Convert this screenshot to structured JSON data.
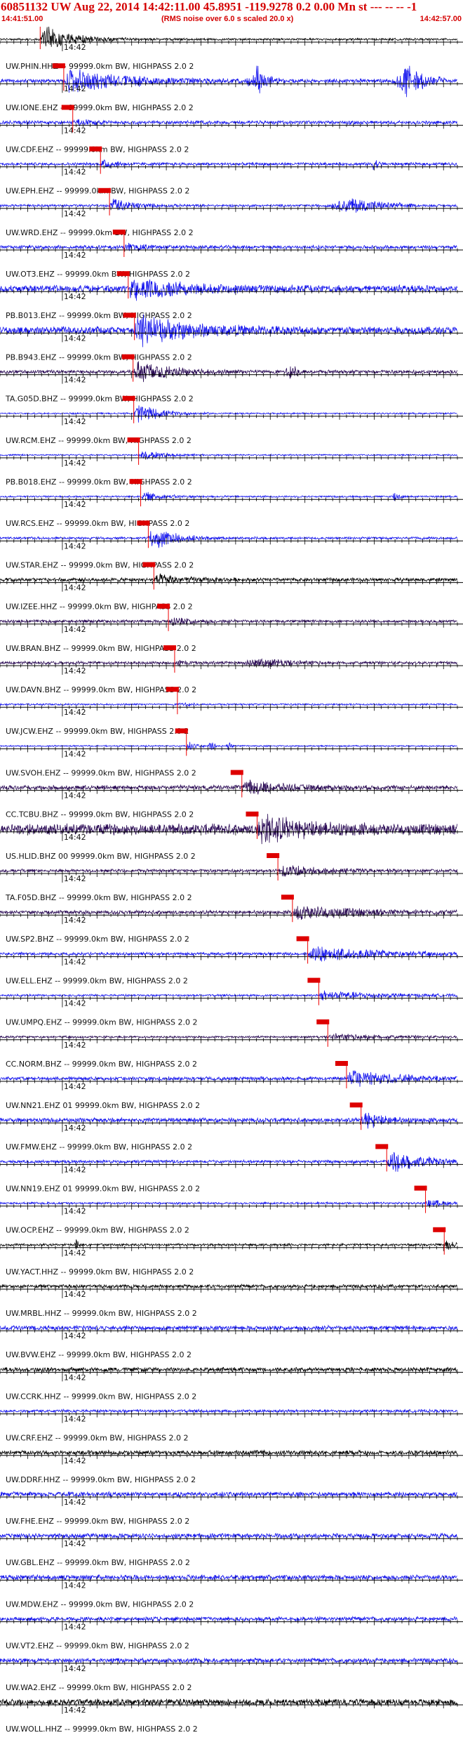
{
  "header": {
    "title": "60851132 UW Aug 22, 2014 14:42:11.00   45.8951 -119.9278  0.2 0.00 Mn st --- -- -- -1",
    "start_time": "14:41:51.00",
    "rms_note": "(RMS noise over 6.0 s scaled 20.0 x)",
    "end_time": "14:42:57.00"
  },
  "colors": {
    "header_text": "#d40000",
    "pick_box": "#dd0000",
    "pick_line": "#ee0000",
    "blue_trace": "#1515ee",
    "black_trace": "#000000",
    "purple_trace": "#2a0a55"
  },
  "chart_data": {
    "type": "line",
    "title": "60851132 UW Aug 22, 2014 14:42:11.00   45.8951 -119.9278  0.2 0.00 Mn st --- -- -- -1",
    "x_unit": "seconds after 14:41:51.00",
    "xlim": [
      0,
      66
    ],
    "tick_label": "14:42",
    "tick_label_at": 9,
    "minor_tick_spacing_s": 1,
    "major_tick_spacing_s": 5,
    "origin_time_s": 20,
    "series": [
      {
        "name": "UW.PHIN.HHZ -- 99999.0km BW, HIGHPASS  2.0  2",
        "color": "black",
        "pick": 5.8,
        "amp": 0.95,
        "noise": 0.07,
        "dur": 9,
        "extra": []
      },
      {
        "name": "UW.IONE.EHZ -- 99999.0km BW, HIGHPASS  2.0  2",
        "color": "blue",
        "pick": 9.2,
        "amp": 0.9,
        "noise": 0.12,
        "dur": 18,
        "extra": [
          [
            37,
            0.9,
            1.5
          ],
          [
            59,
            1.0,
            2.5
          ]
        ]
      },
      {
        "name": "UW.CDF.EHZ -- 99999.0km BW, HIGHPASS  2.0  2",
        "color": "blue",
        "pick": 10.5,
        "amp": 0.22,
        "noise": 0.12,
        "dur": 6,
        "extra": []
      },
      {
        "name": "UW.EPH.EHZ -- 99999.0km BW, HIGHPASS  2.0  2",
        "color": "blue",
        "pick": 14.5,
        "amp": 0.55,
        "noise": 0.1,
        "dur": 3,
        "extra": [
          [
            54,
            0.35,
            0.6
          ]
        ]
      },
      {
        "name": "UW.WRD.EHZ -- 99999.0km BW, HIGHPASS  2.0  2",
        "color": "blue",
        "pick": 15.8,
        "amp": 0.55,
        "noise": 0.08,
        "dur": 6,
        "extra": [
          [
            51,
            0.5,
            4
          ]
        ]
      },
      {
        "name": "UW.OT3.EHZ -- 99999.0km BW, HIGHPASS  2.0  2",
        "color": "blue",
        "pick": 17.9,
        "amp": 0.28,
        "noise": 0.12,
        "dur": 5,
        "extra": []
      },
      {
        "name": "PB.B013.EHZ -- 99999.0km BW, HIGHPASS  2.0  2",
        "color": "blue",
        "pick": 18.5,
        "amp": 0.8,
        "noise": 0.22,
        "dur": 16,
        "extra": []
      },
      {
        "name": "PB.B943.EHZ -- 99999.0km BW, HIGHPASS  2.0  2",
        "color": "blue",
        "pick": 19.4,
        "amp": 0.95,
        "noise": 0.25,
        "dur": 16,
        "extra": []
      },
      {
        "name": "TA.G05D.BHZ -- 99999.0km BW, HIGHPASS  2.0  2",
        "color": "purple",
        "pick": 19.2,
        "amp": 0.75,
        "noise": 0.12,
        "dur": 10,
        "extra": [
          [
            42,
            0.4,
            1
          ]
        ]
      },
      {
        "name": "UW.RCM.EHZ -- 99999.0km BW, HIGHPASS  2.0  2",
        "color": "blue",
        "pick": 19.3,
        "amp": 0.9,
        "noise": 0.05,
        "dur": 6,
        "extra": []
      },
      {
        "name": "PB.B018.EHZ -- 99999.0km BW, HIGHPASS  2.0  2",
        "color": "blue",
        "pick": 20.0,
        "amp": 0.4,
        "noise": 0.05,
        "dur": 6,
        "extra": []
      },
      {
        "name": "UW.RCS.EHZ -- 99999.0km BW, HIGHPASS  2.0  2",
        "color": "blue",
        "pick": 20.3,
        "amp": 0.35,
        "noise": 0.06,
        "dur": 6,
        "extra": [
          [
            57,
            0.35,
            0.6
          ]
        ]
      },
      {
        "name": "UW.STAR.EHZ -- 99999.0km BW, HIGHPASS  2.0  2",
        "color": "blue",
        "pick": 21.4,
        "amp": 0.9,
        "noise": 0.08,
        "dur": 7,
        "extra": []
      },
      {
        "name": "UW.IZEE.HHZ -- 99999.0km BW, HIGHPASS  2.0  2",
        "color": "black",
        "pick": 22.2,
        "amp": 0.35,
        "noise": 0.12,
        "dur": 8,
        "extra": []
      },
      {
        "name": "UW.BRAN.BHZ -- 99999.0km BW, HIGHPASS  2.0  2",
        "color": "purple",
        "pick": 24.3,
        "amp": 0.3,
        "noise": 0.1,
        "dur": 6,
        "extra": []
      },
      {
        "name": "UW.DAVN.BHZ -- 99999.0km BW, HIGHPASS  2.0  2",
        "color": "purple",
        "pick": 25.2,
        "amp": 0.15,
        "noise": 0.1,
        "dur": 4,
        "extra": [
          [
            38,
            0.25,
            4
          ]
        ]
      },
      {
        "name": "UW.JCW.EHZ -- 99999.0km BW, HIGHPASS  2.0  2",
        "color": "blue",
        "pick": 25.6,
        "amp": 0.15,
        "noise": 0.06,
        "dur": 3,
        "extra": []
      },
      {
        "name": "UW.SVOH.EHZ -- 99999.0km BW, HIGHPASS  2.0  2",
        "color": "blue",
        "pick": 26.9,
        "amp": 0.4,
        "noise": 0.05,
        "dur": 2,
        "extra": [
          [
            30.5,
            0.4,
            0.4
          ],
          [
            33,
            0.35,
            0.4
          ]
        ]
      },
      {
        "name": "CC.TCBU.BHZ -- 99999.0km BW, HIGHPASS  2.0  2",
        "color": "purple",
        "pick": 34.9,
        "amp": 0.5,
        "noise": 0.15,
        "dur": 10,
        "extra": []
      },
      {
        "name": "US.HLID.BHZ 00 99999.0km BW, HIGHPASS  2.0  2",
        "color": "purple",
        "pick": 37.1,
        "amp": 0.95,
        "noise": 0.35,
        "dur": 12,
        "extra": []
      },
      {
        "name": "TA.F05D.BHZ -- 99999.0km BW, HIGHPASS  2.0  2",
        "color": "purple",
        "pick": 40.1,
        "amp": 0.45,
        "noise": 0.1,
        "dur": 12,
        "extra": []
      },
      {
        "name": "UW.SP2.BHZ -- 99999.0km BW, HIGHPASS  2.0  2",
        "color": "purple",
        "pick": 42.2,
        "amp": 0.45,
        "noise": 0.12,
        "dur": 20,
        "extra": []
      },
      {
        "name": "UW.ELL.EHZ -- 99999.0km BW, HIGHPASS  2.0  2",
        "color": "blue",
        "pick": 44.4,
        "amp": 0.55,
        "noise": 0.1,
        "dur": 18,
        "extra": []
      },
      {
        "name": "UW.UMPQ.EHZ -- 99999.0km BW, HIGHPASS  2.0  2",
        "color": "blue",
        "pick": 46.0,
        "amp": 0.3,
        "noise": 0.07,
        "dur": 18,
        "extra": []
      },
      {
        "name": "CC.NORM.BHZ -- 99999.0km BW, HIGHPASS  2.0  2",
        "color": "purple",
        "pick": 47.3,
        "amp": 0.2,
        "noise": 0.07,
        "dur": 16,
        "extra": []
      },
      {
        "name": "UW.NN21.EHZ 01 99999.0km BW, HIGHPASS  2.0  2",
        "color": "blue",
        "pick": 50.0,
        "amp": 0.55,
        "noise": 0.12,
        "dur": 15,
        "extra": []
      },
      {
        "name": "UW.FMW.EHZ -- 99999.0km BW, HIGHPASS  2.0  2",
        "color": "blue",
        "pick": 52.1,
        "amp": 0.75,
        "noise": 0.14,
        "dur": 5,
        "extra": []
      },
      {
        "name": "UW.NN19.EHZ 01 99999.0km BW, HIGHPASS  2.0  2",
        "color": "blue",
        "pick": 55.8,
        "amp": 0.8,
        "noise": 0.1,
        "dur": 10,
        "extra": []
      },
      {
        "name": "UW.OCP.EHZ -- 99999.0km BW, HIGHPASS  2.0  2",
        "color": "blue",
        "pick": 61.4,
        "amp": 0.3,
        "noise": 0.07,
        "dur": 5,
        "extra": []
      },
      {
        "name": "UW.YACT.HHZ -- 99999.0km BW, HIGHPASS  2.0  2",
        "color": "black",
        "pick": 64.1,
        "amp": 0.6,
        "noise": 0.08,
        "dur": 2,
        "extra": [
          [
            11,
            0.35,
            0.3
          ]
        ]
      },
      {
        "name": "UW.MRBL.HHZ -- 99999.0km BW, HIGHPASS  2.0  2",
        "color": "black",
        "pick": null,
        "amp": 0,
        "noise": 0.12,
        "dur": 0,
        "extra": []
      },
      {
        "name": "UW.BVW.EHZ -- 99999.0km BW, HIGHPASS  2.0  2",
        "color": "blue",
        "pick": null,
        "amp": 0,
        "noise": 0.15,
        "dur": 0,
        "extra": []
      },
      {
        "name": "UW.CCRK.HHZ -- 99999.0km BW, HIGHPASS  2.0  2",
        "color": "black",
        "pick": null,
        "amp": 0,
        "noise": 0.14,
        "dur": 0,
        "extra": []
      },
      {
        "name": "UW.CRF.EHZ -- 99999.0km BW, HIGHPASS  2.0  2",
        "color": "blue",
        "pick": null,
        "amp": 0,
        "noise": 0.1,
        "dur": 0,
        "extra": []
      },
      {
        "name": "UW.DDRF.HHZ -- 99999.0km BW, HIGHPASS  2.0  2",
        "color": "black",
        "pick": null,
        "amp": 0,
        "noise": 0.15,
        "dur": 0,
        "extra": []
      },
      {
        "name": "UW.FHE.EHZ -- 99999.0km BW, HIGHPASS  2.0  2",
        "color": "blue",
        "pick": null,
        "amp": 0,
        "noise": 0.15,
        "dur": 0,
        "extra": []
      },
      {
        "name": "UW.GBL.EHZ -- 99999.0km BW, HIGHPASS  2.0  2",
        "color": "blue",
        "pick": null,
        "amp": 0,
        "noise": 0.16,
        "dur": 0,
        "extra": []
      },
      {
        "name": "UW.MDW.EHZ -- 99999.0km BW, HIGHPASS  2.0  2",
        "color": "blue",
        "pick": null,
        "amp": 0,
        "noise": 0.16,
        "dur": 0,
        "extra": []
      },
      {
        "name": "UW.VT2.EHZ -- 99999.0km BW, HIGHPASS  2.0  2",
        "color": "blue",
        "pick": null,
        "amp": 0,
        "noise": 0.14,
        "dur": 0,
        "extra": []
      },
      {
        "name": "UW.WA2.EHZ -- 99999.0km BW, HIGHPASS  2.0  2",
        "color": "blue",
        "pick": null,
        "amp": 0,
        "noise": 0.15,
        "dur": 0,
        "extra": []
      },
      {
        "name": "UW.WOLL.HHZ -- 99999.0km BW, HIGHPASS  2.0  2",
        "color": "black",
        "pick": null,
        "amp": 0,
        "noise": 0.2,
        "dur": 0,
        "extra": []
      }
    ]
  }
}
